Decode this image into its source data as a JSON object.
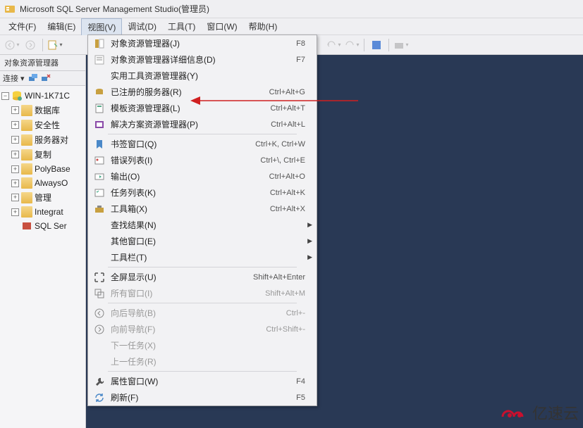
{
  "title": "Microsoft SQL Server Management Studio(管理员)",
  "menubar": {
    "file": "文件(F)",
    "edit": "编辑(E)",
    "view": "视图(V)",
    "debug": "调试(D)",
    "tools": "工具(T)",
    "window": "窗口(W)",
    "help": "帮助(H)"
  },
  "sidebar": {
    "title": "对象资源管理器",
    "connect": "连接 ▾",
    "root": "WIN-1K71C",
    "nodes": {
      "database": "数据库",
      "security": "安全性",
      "server_objects": "服务器对",
      "replication": "复制",
      "polybase": "PolyBase",
      "alwayson": "AlwaysO",
      "management": "管理",
      "integration": "Integrat",
      "sql_agent": "SQL Ser"
    }
  },
  "menu": {
    "items": [
      {
        "label": "对象资源管理器(J)",
        "shortcut": "F8",
        "icon": "objexp"
      },
      {
        "label": "对象资源管理器详细信息(D)",
        "shortcut": "F7",
        "icon": "objexp-detail"
      },
      {
        "label": "实用工具资源管理器(Y)",
        "shortcut": "",
        "icon": ""
      },
      {
        "label": "已注册的服务器(R)",
        "shortcut": "Ctrl+Alt+G",
        "icon": "reg-server"
      },
      {
        "label": "模板资源管理器(L)",
        "shortcut": "Ctrl+Alt+T",
        "icon": "template"
      },
      {
        "label": "解决方案资源管理器(P)",
        "shortcut": "Ctrl+Alt+L",
        "icon": "solution"
      },
      {
        "sep": true
      },
      {
        "label": "书签窗口(Q)",
        "shortcut": "Ctrl+K, Ctrl+W",
        "icon": "bookmark"
      },
      {
        "label": "错误列表(I)",
        "shortcut": "Ctrl+\\, Ctrl+E",
        "icon": "error-list"
      },
      {
        "label": "输出(O)",
        "shortcut": "Ctrl+Alt+O",
        "icon": "output"
      },
      {
        "label": "任务列表(K)",
        "shortcut": "Ctrl+Alt+K",
        "icon": "tasks"
      },
      {
        "label": "工具箱(X)",
        "shortcut": "Ctrl+Alt+X",
        "icon": "toolbox"
      },
      {
        "label": "查找结果(N)",
        "shortcut": "",
        "submenu": true
      },
      {
        "label": "其他窗口(E)",
        "shortcut": "",
        "submenu": true
      },
      {
        "label": "工具栏(T)",
        "shortcut": "",
        "submenu": true
      },
      {
        "sep": true
      },
      {
        "label": "全屏显示(U)",
        "shortcut": "Shift+Alt+Enter",
        "icon": "fullscreen"
      },
      {
        "label": "所有窗口(I)",
        "shortcut": "Shift+Alt+M",
        "icon": "windows",
        "disabled": true
      },
      {
        "sep": true
      },
      {
        "label": "向后导航(B)",
        "shortcut": "Ctrl+-",
        "icon": "nav-back",
        "disabled": true
      },
      {
        "label": "向前导航(F)",
        "shortcut": "Ctrl+Shift+-",
        "icon": "nav-fwd",
        "disabled": true
      },
      {
        "label": "下一任务(X)",
        "shortcut": "",
        "disabled": true
      },
      {
        "label": "上一任务(R)",
        "shortcut": "",
        "disabled": true
      },
      {
        "sep": true
      },
      {
        "label": "属性窗口(W)",
        "shortcut": "F4",
        "icon": "wrench"
      },
      {
        "label": "刷新(F)",
        "shortcut": "F5",
        "icon": "refresh"
      }
    ]
  },
  "watermark": "亿速云"
}
